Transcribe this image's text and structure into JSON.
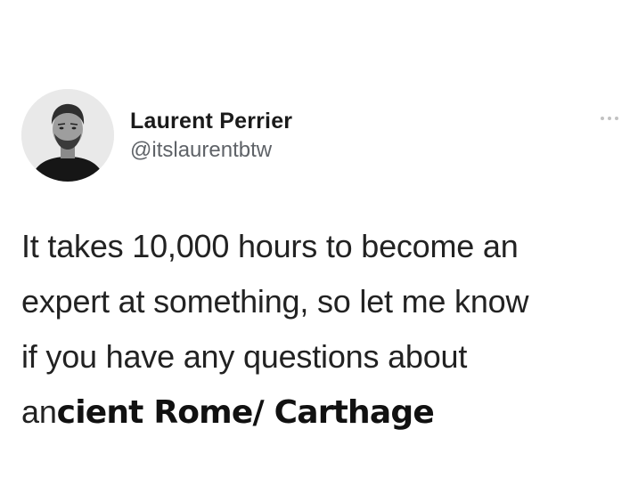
{
  "tweet": {
    "author": {
      "display_name": "Laurent Perrier",
      "handle": "@itslaurentbtw",
      "avatar_icon": "profile-photo"
    },
    "more_icon": "ellipsis-icon",
    "text": {
      "lines": [
        "It takes 10,000 hours to become an",
        "expert at something, so let me know",
        "if you have any questions about",
        "an"
      ],
      "accent_text": "cient Rome/ Carthage"
    }
  }
}
